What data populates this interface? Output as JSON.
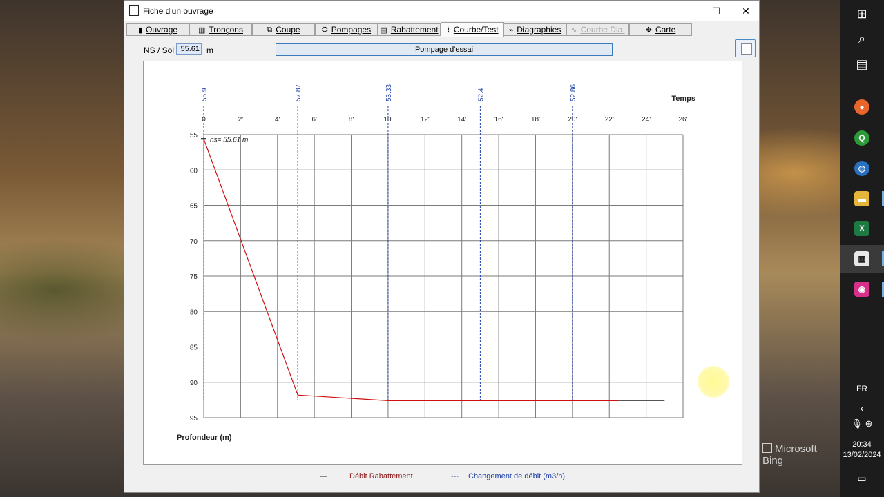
{
  "window": {
    "title": "Fiche d'un ouvrage",
    "minimize": "—",
    "maximize": "☐",
    "close": "✕"
  },
  "tabs": [
    {
      "label": "Ouvrage",
      "icon": "book-icon"
    },
    {
      "label": "Tronçons",
      "icon": "bars-icon"
    },
    {
      "label": "Coupe",
      "icon": "section-icon"
    },
    {
      "label": "Pompages",
      "icon": "pump-icon"
    },
    {
      "label": "Rabattement",
      "icon": "list-icon"
    },
    {
      "label": "Courbe/Test",
      "icon": "curve-icon",
      "active": true
    },
    {
      "label": "Diagraphies",
      "icon": "log-icon"
    },
    {
      "label": "Courbe Dia.",
      "icon": "wave-icon",
      "disabled": true
    },
    {
      "label": "Carte",
      "icon": "map-icon"
    }
  ],
  "toolbar": {
    "ns_label": "NS / Sol :",
    "ns_value": "55.61",
    "ns_unit": "m",
    "pump_button": "Pompage d'essai"
  },
  "chart_data": {
    "type": "line",
    "xlabel": "Temps",
    "ylabel": "Profondeur (m)",
    "x_ticks": [
      "0",
      "2'",
      "4'",
      "6'",
      "8'",
      "10'",
      "12'",
      "14'",
      "16'",
      "18'",
      "20'",
      "22'",
      "24'",
      "26'"
    ],
    "xlim": [
      0,
      26
    ],
    "ylim": [
      55,
      95
    ],
    "y_ticks": [
      55,
      60,
      65,
      70,
      75,
      80,
      85,
      90,
      95
    ],
    "y_inverted": true,
    "grid": true,
    "annotation": "ns= 55.61 m",
    "series": [
      {
        "name": "Débit Rabattement",
        "color": "#d01010",
        "points": [
          [
            0,
            55.61
          ],
          [
            5.1,
            91.8
          ],
          [
            10,
            92.6
          ],
          [
            22.5,
            92.6
          ]
        ]
      },
      {
        "color": "#555555",
        "points": [
          [
            22.5,
            92.6
          ],
          [
            25,
            92.6
          ]
        ]
      }
    ],
    "flow_changes": [
      {
        "x": 0,
        "label": "55.9"
      },
      {
        "x": 5.1,
        "label": "57.87"
      },
      {
        "x": 10,
        "label": "53.33"
      },
      {
        "x": 15,
        "label": "52.4"
      },
      {
        "x": 20,
        "label": "52.86"
      }
    ],
    "legend": [
      {
        "label": "Débit Rabattement",
        "color": "#8b1a1a",
        "marker": "—"
      },
      {
        "label": "Changement de débit (m3/h)",
        "color": "#1e3ea8",
        "marker": "---"
      }
    ]
  },
  "taskbar": {
    "lang": "FR",
    "time": "20:34",
    "date": "13/02/2024"
  },
  "desktop": {
    "watermark": "Microsoft Bing"
  }
}
